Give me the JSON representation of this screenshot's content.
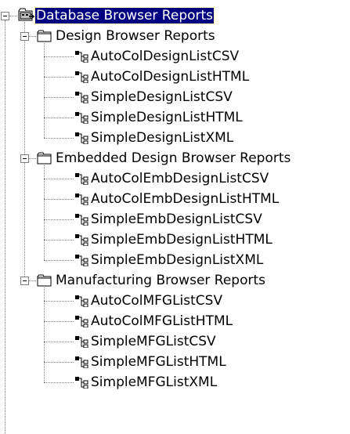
{
  "tree": {
    "root": {
      "label": "Database Browser Reports",
      "icon": "database-folder-icon",
      "expanded": true,
      "selected": true
    },
    "groups": [
      {
        "label": "Design Browser Reports",
        "icon": "folder-icon",
        "expanded": true,
        "items": [
          "AutoColDesignListCSV",
          "AutoColDesignListHTML",
          "SimpleDesignListCSV",
          "SimpleDesignListHTML",
          "SimpleDesignListXML"
        ]
      },
      {
        "label": "Embedded Design Browser Reports",
        "icon": "folder-icon",
        "expanded": true,
        "items": [
          "AutoColEmbDesignListCSV",
          "AutoColEmbDesignListHTML",
          "SimpleEmbDesignListCSV",
          "SimpleEmbDesignListHTML",
          "SimpleEmbDesignListXML"
        ]
      },
      {
        "label": "Manufacturing Browser Reports",
        "icon": "folder-icon",
        "expanded": true,
        "items": [
          "AutoColMFGListCSV",
          "AutoColMFGListHTML",
          "SimpleMFGListCSV",
          "SimpleMFGListHTML",
          "SimpleMFGListXML"
        ]
      }
    ],
    "item_icon": "report-node-icon",
    "colors": {
      "selection_bg": "#000080",
      "selection_fg": "#ffffff",
      "connector": "#808080"
    }
  }
}
